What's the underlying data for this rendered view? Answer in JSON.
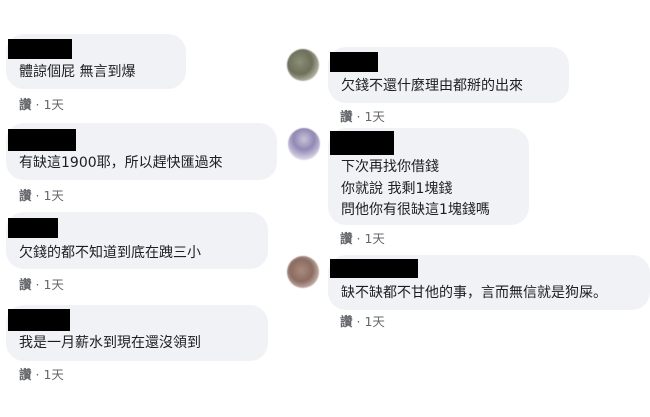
{
  "left_comments": [
    {
      "text": "體諒個屁 無言到爆",
      "like": "讚",
      "sep": "·",
      "time": "1天"
    },
    {
      "text": "有缺這1900耶，所以趕快匯過來",
      "like": "讚",
      "sep": "·",
      "time": "1天"
    },
    {
      "text": "欠錢的都不知道到底在跩三小",
      "like": "讚",
      "sep": "·",
      "time": "1天"
    },
    {
      "text": "我是一月薪水到現在還沒領到",
      "like": "讚",
      "sep": "·",
      "time": "1天"
    }
  ],
  "right_comments": [
    {
      "lines": [
        "欠錢不還什麼理由都掰的出來"
      ],
      "like": "讚",
      "sep": "·",
      "time": "1天"
    },
    {
      "lines": [
        "下次再找你借錢",
        "你就說 我剩1塊錢",
        "問他你有很缺這1塊錢嗎"
      ],
      "like": "讚",
      "sep": "·",
      "time": "1天"
    },
    {
      "lines": [
        "缺不缺都不甘他的事，言而無信就是狗屎。"
      ],
      "like": "讚",
      "sep": "·",
      "time": "1天"
    }
  ],
  "colors": {
    "bubble": "#f0f2f5",
    "text": "#1c1e21",
    "meta": "#65676b",
    "redaction": "#000000"
  }
}
